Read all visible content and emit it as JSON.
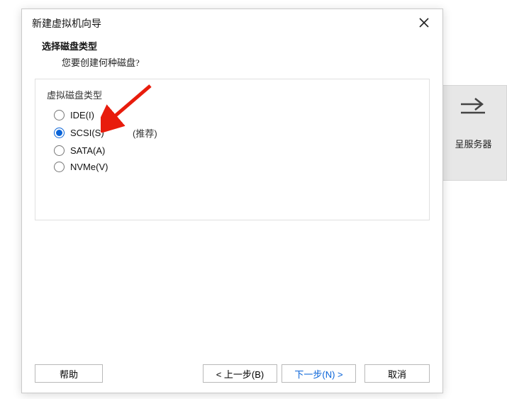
{
  "background_panel": {
    "icon_name": "arrow-right-icon",
    "label_fragment": "呈服务器"
  },
  "dialog": {
    "title": "新建虚拟机向导",
    "subheader": {
      "title": "选择磁盘类型",
      "description": "您要创建何种磁盘?"
    },
    "group_label": "虚拟磁盘类型",
    "options": [
      {
        "label": "IDE(I)",
        "hint": "",
        "selected": false
      },
      {
        "label": "SCSI(S)",
        "hint": "(推荐)",
        "selected": true
      },
      {
        "label": "SATA(A)",
        "hint": "",
        "selected": false
      },
      {
        "label": "NVMe(V)",
        "hint": "",
        "selected": false
      }
    ],
    "footer": {
      "help": "帮助",
      "back": "< 上一步(B)",
      "next": "下一步(N) >",
      "cancel": "取消"
    },
    "annotation_arrow_color": "#e81c0c"
  }
}
